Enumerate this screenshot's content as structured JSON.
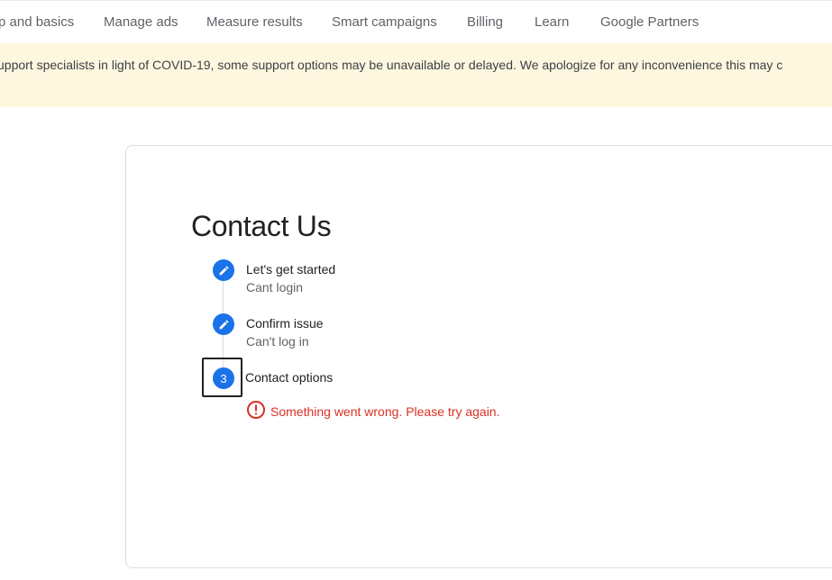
{
  "nav": {
    "items": [
      {
        "label": "p and basics"
      },
      {
        "label": "Manage ads"
      },
      {
        "label": "Measure results"
      },
      {
        "label": "Smart campaigns"
      },
      {
        "label": "Billing"
      },
      {
        "label": "Learn"
      },
      {
        "label": "Google Partners"
      }
    ]
  },
  "banner": {
    "text": "upport specialists in light of COVID-19, some support options may be unavailable or delayed. We apologize for any inconvenience this may c"
  },
  "contact": {
    "title": "Contact Us",
    "steps": [
      {
        "title": "Let's get started",
        "subtitle": "Cant login",
        "icon": "pencil-icon"
      },
      {
        "title": "Confirm issue",
        "subtitle": "Can't log in",
        "icon": "pencil-icon"
      },
      {
        "title": "Contact options",
        "number": "3"
      }
    ],
    "error": {
      "icon": "error-icon",
      "text": "Something went wrong. Please try again."
    }
  },
  "colors": {
    "accent": "#1a73e8",
    "error": "#d93025",
    "banner_bg": "#fef7e0"
  }
}
